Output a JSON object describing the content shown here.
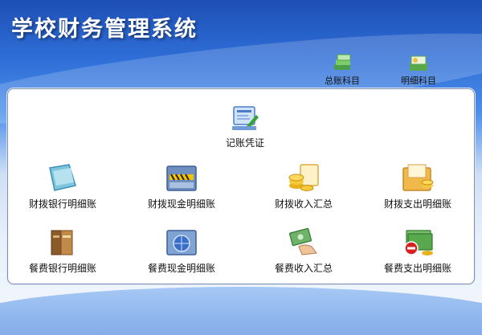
{
  "app": {
    "title": "学校财务管理系统"
  },
  "top_links": [
    {
      "label": "总账科目",
      "icon": "ledger-stack-icon"
    },
    {
      "label": "明细科目",
      "icon": "detail-ledger-icon"
    }
  ],
  "center_item": {
    "label": "记账凭证",
    "icon": "voucher-icon"
  },
  "grid": [
    {
      "label": "财拨银行明细账",
      "icon": "bank-folder-icon"
    },
    {
      "label": "财拨现金明细账",
      "icon": "cash-folder-icon"
    },
    {
      "label": "财拨收入汇总",
      "icon": "coins-income-icon"
    },
    {
      "label": "财拨支出明细账",
      "icon": "expense-folder-icon"
    },
    {
      "label": "餐费银行明细账",
      "icon": "books-icon"
    },
    {
      "label": "餐费现金明细账",
      "icon": "globe-folder-icon"
    },
    {
      "label": "餐费收入汇总",
      "icon": "money-hand-icon"
    },
    {
      "label": "餐费支出明细账",
      "icon": "cash-minus-icon"
    }
  ],
  "colors": {
    "accent": "#2f6fd8",
    "panel_border": "#7f8fb0",
    "title_text": "#ffffff"
  }
}
